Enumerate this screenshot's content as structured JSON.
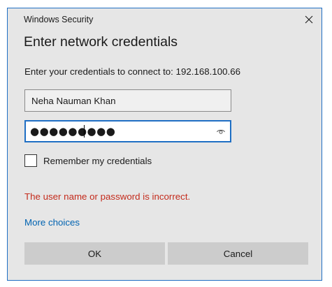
{
  "window": {
    "title": "Windows Security",
    "close_icon": "close-icon"
  },
  "dialog": {
    "heading": "Enter network credentials",
    "prompt": "Enter your credentials to connect to: 192.168.100.66"
  },
  "form": {
    "username_value": "Neha Nauman Khan",
    "password_masked": "●●●●●●●●●",
    "reveal_icon": "eye-icon",
    "remember_label": "Remember my credentials",
    "remember_checked": false
  },
  "error_message": "The user name or password is incorrect.",
  "more_choices_label": "More choices",
  "buttons": {
    "ok_label": "OK",
    "cancel_label": "Cancel"
  },
  "colors": {
    "accent": "#1f6fc4",
    "error": "#c42b1c",
    "link": "#0063b1",
    "dialog_bg": "#e6e6e6",
    "button_bg": "#cccccc"
  }
}
